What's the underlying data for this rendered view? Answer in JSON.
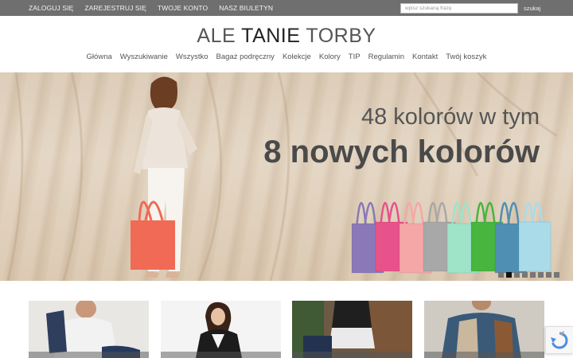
{
  "topbar": {
    "links": [
      "ZALOGUJ SIĘ",
      "ZAREJESTRUJ SIĘ",
      "TWOJE KONTO",
      "NASZ BIULETYN"
    ],
    "search_placeholder": "wpisz szukaną frazę",
    "search_button": "szukaj"
  },
  "logo": {
    "part1": "ALE ",
    "part2": "TANIE",
    "part3": " TORBY"
  },
  "nav": [
    "Główna",
    "Wyszukiwanie",
    "Wszystko",
    "Bagaż podręczny",
    "Kolekcje",
    "Kolory",
    "TIP",
    "Regulamin",
    "Kontakt",
    "Twój koszyk"
  ],
  "hero": {
    "line1": "48 kolorów w tym",
    "line2": "8 nowych kolorów",
    "bag_colors": [
      "#f06a55",
      "#8a78b8",
      "#e8528a",
      "#f5a7a7",
      "#a8a8a8",
      "#9fe3c9",
      "#47b53e",
      "#4f8fb3",
      "#a9dbe9"
    ],
    "slides": 8,
    "active_slide": 2
  },
  "products": [
    "backpack-man",
    "woman-black-blazer",
    "woman-suitcase",
    "man-backpack-shirt"
  ]
}
